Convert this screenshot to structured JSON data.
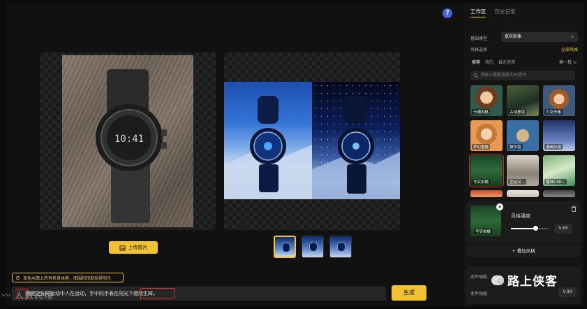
{
  "help": {
    "label": "?"
  },
  "canvas": {
    "upload_label": "上传图片",
    "hint_text": "显色水面上的有机身体着，阁围和顶部反射阳光",
    "prompt_text": "这是之光的运动中人在运动，手中的手表在阳光下熠熠生辉。",
    "generate_label": "生成"
  },
  "thumbs": [
    {
      "active": true
    },
    {
      "active": false
    },
    {
      "active": false
    }
  ],
  "sidebar": {
    "tabs": [
      "工作区",
      "历史记录"
    ],
    "active_tab": 0,
    "base_model": {
      "label": "基础模型",
      "value": "真实影像"
    },
    "style": {
      "label": "风格选择",
      "all_label": "全部风格"
    },
    "subtabs": [
      "推荐",
      "我的",
      "最近使用"
    ],
    "refresh_label": "换一批",
    "search_placeholder": "请输入需要搜索的关键词",
    "style_cards": [
      {
        "name": "卡通风格"
      },
      {
        "name": "古诗意境"
      },
      {
        "name": "少女头像"
      },
      {
        "name": "梦幻童趣"
      },
      {
        "name": "鼓尔兔"
      },
      {
        "name": "漫画分镜"
      },
      {
        "name": "写实拍摄",
        "selected": true
      },
      {
        "name": "宫廷汉…"
      },
      {
        "name": "趣味C4D…"
      },
      {
        "name": ""
      },
      {
        "name": ""
      },
      {
        "name": ""
      }
    ],
    "strength": {
      "card": "写实拍摄",
      "label": "风格强度",
      "value": "0.65",
      "level": 0.65
    },
    "add_style_label": "+ 叠加风格",
    "condition": {
      "label": "条件强度",
      "value": "0.90"
    }
  },
  "watermarks": {
    "left": "人数跨境",
    "right": "路上侠客"
  },
  "colors": {
    "accent": "#f2c230",
    "highlight": "#e02b2b",
    "help": "#4a63d6"
  }
}
